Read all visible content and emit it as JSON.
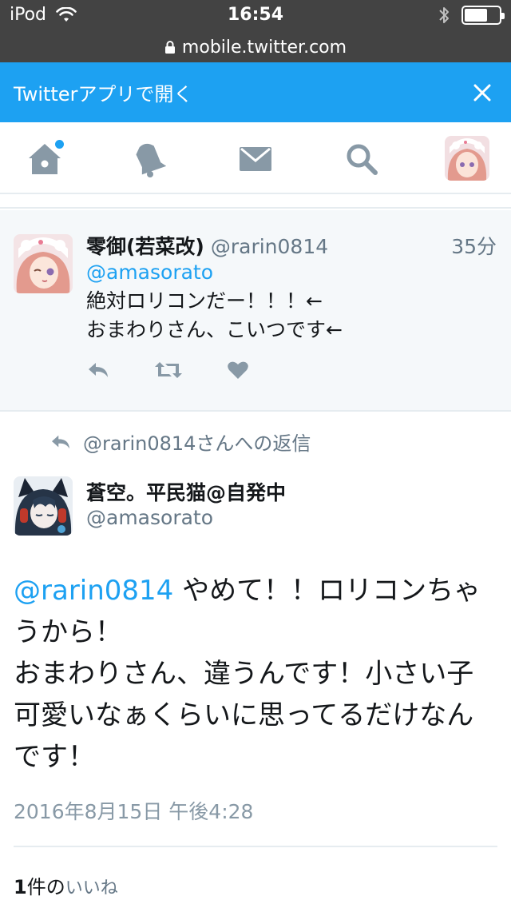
{
  "status_bar": {
    "carrier": "iPod",
    "time": "16:54"
  },
  "browser": {
    "url": "mobile.twitter.com"
  },
  "app_banner": {
    "label": "Twitterアプリで開く"
  },
  "nav": {
    "items": [
      "home-icon",
      "bell-icon",
      "mail-icon",
      "search-icon",
      "avatar"
    ],
    "accent": "#1da1f2",
    "icon_color": "#8899a6"
  },
  "parent_tweet": {
    "name": "零御(若菜改)",
    "handle": "@rarin0814",
    "time": "35分",
    "mention": "@amasorato",
    "line1": "絶対ロリコンだー！！！←",
    "line2": "おまわりさん、こいつです←"
  },
  "reply_context": {
    "text": "@rarin0814さんへの返信"
  },
  "main_tweet": {
    "name": "蒼空。平民猫@自発中",
    "handle": "@amasorato",
    "mention": "@rarin0814",
    "text_part1": " やめて！！ロリコンちゃうから！",
    "text_part2": "おまわりさん、違うんです！小さい子可愛いなぁくらいに思ってるだけなんです！",
    "date": "2016年8月15日 午後4:28"
  },
  "likes": {
    "count": "1",
    "unit": "件の",
    "label": "いいね"
  }
}
